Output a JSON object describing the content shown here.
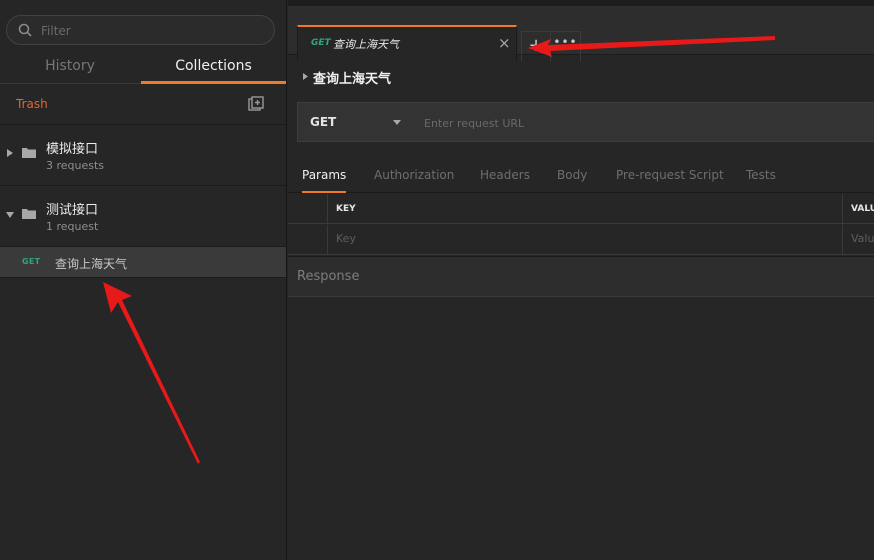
{
  "sidebar": {
    "filter_placeholder": "Filter",
    "tabs": {
      "history": "History",
      "collections": "Collections",
      "active": "collections"
    },
    "trash_label": "Trash",
    "collections": [
      {
        "name": "模拟接口",
        "count": "3 requests",
        "expanded": false
      },
      {
        "name": "测试接口",
        "count": "1 request",
        "expanded": true,
        "requests": [
          {
            "method": "GET",
            "name": "查询上海天气"
          }
        ]
      }
    ]
  },
  "main": {
    "open_tab": {
      "method": "GET",
      "name": "查询上海天气",
      "close": "×"
    },
    "new_tab": "+",
    "more": "•••",
    "request_title": "查询上海天气",
    "method": "GET",
    "url_placeholder": "Enter request URL",
    "request_tabs": [
      "Params",
      "Authorization",
      "Headers",
      "Body",
      "Pre-request Script",
      "Tests"
    ],
    "active_request_tab": "Params",
    "params": {
      "headers": {
        "key": "KEY",
        "value": "VALU"
      },
      "key_placeholder": "Key",
      "value_placeholder": "Valu"
    },
    "response_label": "Response"
  },
  "colors": {
    "accent": "#ef7a2c",
    "get_method": "#2ea67a",
    "trash": "#e0662b",
    "annotation_arrow": "#e81919"
  }
}
